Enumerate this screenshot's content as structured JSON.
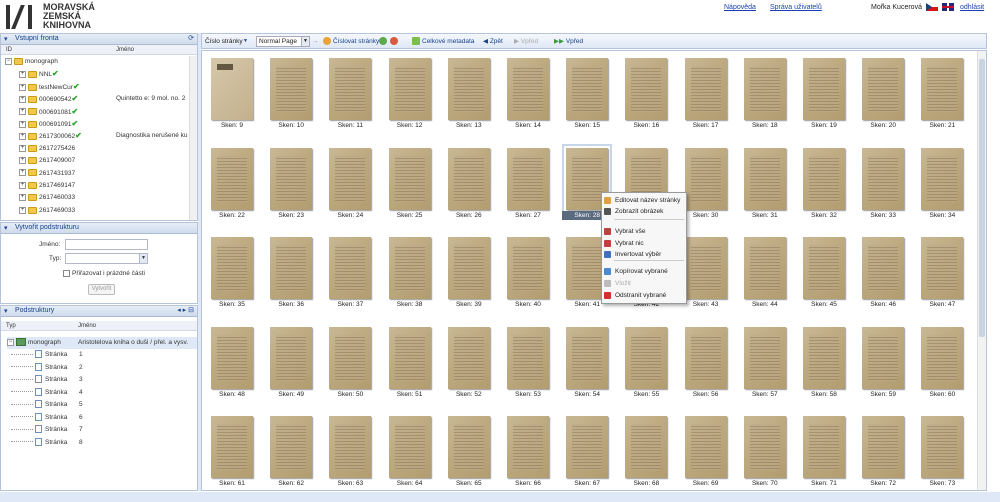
{
  "header": {
    "logo_lines": [
      "MORAVSKÁ",
      "ZEMSKÁ",
      "KNIHOVNA"
    ],
    "links": [
      "Nápověda",
      "Správa uživatelů"
    ],
    "user": "Mořka Kucerová",
    "logout": "odhlásit"
  },
  "input_queue": {
    "title": "Vstupní fronta",
    "col_id": "ID",
    "col_name": "Jméno",
    "rows": [
      {
        "label": "monograph",
        "level": 0,
        "exp": "−",
        "check": false,
        "desc": ""
      },
      {
        "label": "NNL",
        "level": 1,
        "exp": "+",
        "check": true,
        "desc": ""
      },
      {
        "label": "testNewCur",
        "level": 1,
        "exp": "+",
        "check": true,
        "desc": ""
      },
      {
        "label": "000690542",
        "level": 1,
        "exp": "+",
        "check": true,
        "desc": "Quintetto e: 9 mol. no. 2"
      },
      {
        "label": "000691081",
        "level": 1,
        "exp": "+",
        "check": true,
        "desc": ""
      },
      {
        "label": "000691091",
        "level": 1,
        "exp": "+",
        "check": true,
        "desc": ""
      },
      {
        "label": "2617300062",
        "level": 1,
        "exp": "+",
        "check": true,
        "desc": "Diagnostika nerušené ku"
      },
      {
        "label": "2617275426",
        "level": 1,
        "exp": "+",
        "check": false,
        "desc": ""
      },
      {
        "label": "2617409007",
        "level": 1,
        "exp": "+",
        "check": false,
        "desc": ""
      },
      {
        "label": "2617431937",
        "level": 1,
        "exp": "+",
        "check": false,
        "desc": ""
      },
      {
        "label": "2617469147",
        "level": 1,
        "exp": "+",
        "check": false,
        "desc": ""
      },
      {
        "label": "2617460033",
        "level": 1,
        "exp": "+",
        "check": false,
        "desc": ""
      },
      {
        "label": "2617469033",
        "level": 1,
        "exp": "+",
        "check": false,
        "desc": ""
      }
    ]
  },
  "create_struct": {
    "title": "Vytvořit podstrukturu",
    "name_label": "Jméno:",
    "type_label": "Typ:",
    "name_value": "",
    "type_value": "",
    "checkbox_label": "Přiřazovat i prázdné části",
    "create_button": "Vytvořit"
  },
  "substructures": {
    "title": "Podstruktury",
    "col_type": "Typ",
    "col_name": "Jméno",
    "root": {
      "type": "monograph",
      "name": "Aristotelova kniha o duši / přel. a vysv."
    },
    "pages": [
      {
        "type": "Stránka",
        "name": "1"
      },
      {
        "type": "Stránka",
        "name": "2"
      },
      {
        "type": "Stránka",
        "name": "3"
      },
      {
        "type": "Stránka",
        "name": "4"
      },
      {
        "type": "Stránka",
        "name": "5"
      },
      {
        "type": "Stránka",
        "name": "6"
      },
      {
        "type": "Stránka",
        "name": "7"
      },
      {
        "type": "Stránka",
        "name": "8"
      }
    ]
  },
  "toolbar": {
    "page_number": "Číslo stránky",
    "page_type": "Normal Page",
    "numbering_label": "Číslovat stránky",
    "metadata_label": "Celkové metadata",
    "back_label": "Zpět",
    "forward_label": "Vpřed",
    "next_label": "Vpřed"
  },
  "grid": {
    "rows": [
      [
        "Sken: 9",
        "Sken: 10",
        "Sken: 11",
        "Sken: 12",
        "Sken: 13",
        "Sken: 14",
        "Sken: 15",
        "Sken: 16",
        "Sken: 17",
        "Sken: 18",
        "Sken: 19",
        "Sken: 20",
        "Sken: 21"
      ],
      [
        "Sken: 22",
        "Sken: 23",
        "Sken: 24",
        "Sken: 25",
        "Sken: 26",
        "Sken: 27",
        "Sken: 28",
        "Sken: 29",
        "Sken: 30",
        "Sken: 31",
        "Sken: 32",
        "Sken: 33",
        "Sken: 34"
      ],
      [
        "Sken: 35",
        "Sken: 36",
        "Sken: 37",
        "Sken: 38",
        "Sken: 39",
        "Sken: 40",
        "Sken: 41",
        "Sken: 42",
        "Sken: 43",
        "Sken: 44",
        "Sken: 45",
        "Sken: 46",
        "Sken: 47"
      ],
      [
        "Sken: 48",
        "Sken: 49",
        "Sken: 50",
        "Sken: 51",
        "Sken: 52",
        "Sken: 53",
        "Sken: 54",
        "Sken: 55",
        "Sken: 56",
        "Sken: 57",
        "Sken: 58",
        "Sken: 59",
        "Sken: 60"
      ],
      [
        "Sken: 61",
        "Sken: 62",
        "Sken: 63",
        "Sken: 64",
        "Sken: 65",
        "Sken: 66",
        "Sken: 67",
        "Sken: 68",
        "Sken: 69",
        "Sken: 70",
        "Sken: 71",
        "Sken: 72",
        "Sken: 73"
      ]
    ],
    "selected": "Sken: 28"
  },
  "context_menu": {
    "items": [
      {
        "label": "Editovat název stránky",
        "disabled": false,
        "icon": "edit-icon"
      },
      {
        "label": "Zobrazit obrázek",
        "disabled": false,
        "icon": "eye-icon"
      },
      {
        "label": "Vybrat vše",
        "disabled": false,
        "icon": "select-all-icon"
      },
      {
        "label": "Vybrat nic",
        "disabled": false,
        "icon": "select-none-icon"
      },
      {
        "label": "Invertovat výběr",
        "disabled": false,
        "icon": "invert-icon"
      },
      {
        "label": "Kopírovat vybrané",
        "disabled": false,
        "icon": "copy-icon"
      },
      {
        "label": "Vložit",
        "disabled": true,
        "icon": "paste-icon"
      },
      {
        "label": "Odstranit vybrané",
        "disabled": false,
        "icon": "delete-icon"
      }
    ]
  },
  "colors": {
    "accent": "#15428b",
    "link": "#1a3fb0",
    "panel_border": "#b5c4d9"
  }
}
